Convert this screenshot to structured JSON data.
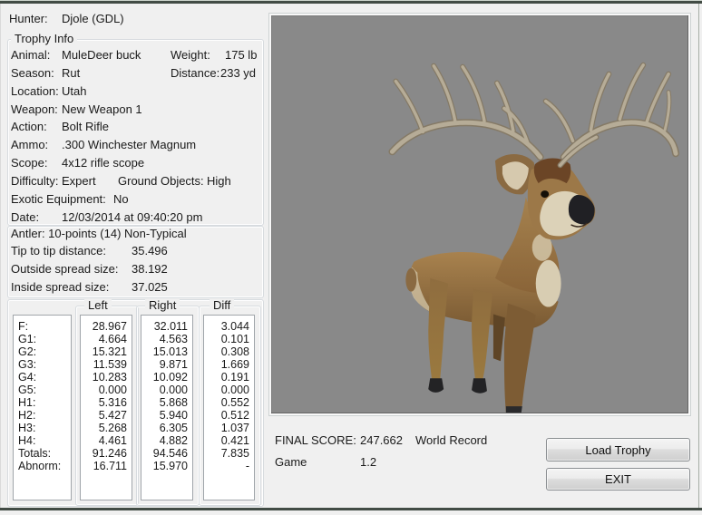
{
  "window": {
    "hunter_label": "Hunter:",
    "hunter_value": "Djole (GDL)"
  },
  "trophy_info": {
    "title": "Trophy Info",
    "animal_label": "Animal:",
    "animal_value": "MuleDeer buck",
    "weight_label": "Weight:",
    "weight_value": "175 lb",
    "season_label": "Season:",
    "season_value": "Rut",
    "distance_label": "Distance:",
    "distance_value": "233 yd",
    "location_label": "Location:",
    "location_value": "Utah",
    "weapon_label": "Weapon:",
    "weapon_value": "New Weapon 1",
    "action_label": "Action:",
    "action_value": "Bolt Rifle",
    "ammo_label": "Ammo:",
    "ammo_value": ".300 Winchester Magnum",
    "scope_label": "Scope:",
    "scope_value": "4x12 rifle scope",
    "difficulty_label": "Difficulty:",
    "difficulty_value": "Expert",
    "ground_objects_label": "Ground Objects:",
    "ground_objects_value": "High",
    "exotic_label": "Exotic Equipment:",
    "exotic_value": "No",
    "date_label": "Date:",
    "date_value": "12/03/2014 at 09:40:20 pm"
  },
  "antler_info": {
    "summary": "Antler: 10-points (14) Non-Typical",
    "tip_label": "Tip to tip distance:",
    "tip_value": "35.496",
    "outside_label": "Outside spread size:",
    "outside_value": "38.192",
    "inside_label": "Inside spread size:",
    "inside_value": "37.025"
  },
  "measurements": {
    "columns": [
      "Left",
      "Right",
      "Diff"
    ],
    "rows": [
      {
        "label": "F:",
        "left": "28.967",
        "right": "32.011",
        "diff": "3.044"
      },
      {
        "label": "G1:",
        "left": "4.664",
        "right": "4.563",
        "diff": "0.101"
      },
      {
        "label": "G2:",
        "left": "15.321",
        "right": "15.013",
        "diff": "0.308"
      },
      {
        "label": "G3:",
        "left": "11.539",
        "right": "9.871",
        "diff": "1.669"
      },
      {
        "label": "G4:",
        "left": "10.283",
        "right": "10.092",
        "diff": "0.191"
      },
      {
        "label": "G5:",
        "left": "0.000",
        "right": "0.000",
        "diff": "0.000"
      },
      {
        "label": "H1:",
        "left": "5.316",
        "right": "5.868",
        "diff": "0.552"
      },
      {
        "label": "H2:",
        "left": "5.427",
        "right": "5.940",
        "diff": "0.512"
      },
      {
        "label": "H3:",
        "left": "5.268",
        "right": "6.305",
        "diff": "1.037"
      },
      {
        "label": "H4:",
        "left": "4.461",
        "right": "4.882",
        "diff": "0.421"
      },
      {
        "label": "Totals:",
        "left": "91.246",
        "right": "94.546",
        "diff": "7.835"
      },
      {
        "label": "Abnorm:",
        "left": "16.711",
        "right": "15.970",
        "diff": "-"
      }
    ]
  },
  "score": {
    "final_label": "FINAL SCORE:",
    "final_value": "247.662",
    "record_text": "World Record",
    "game_label": "Game",
    "game_value": "1.2"
  },
  "buttons": {
    "load_trophy": "Load Trophy",
    "exit": "EXIT"
  },
  "viewport": {
    "description": "3D render of mule deer buck trophy",
    "background": "#898989"
  },
  "colors": {
    "dialog_bg": "#f0f0f0",
    "viewport_bg": "#898989",
    "deer_body": "#96713f",
    "antler": "#b6ac97",
    "window_edge": "#424c45"
  }
}
